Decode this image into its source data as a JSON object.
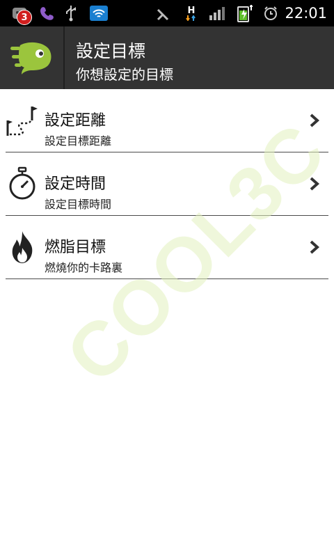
{
  "status_bar": {
    "notification_count": "3",
    "time": "22:01",
    "network_label": "H",
    "icons": [
      "app-notification-icon",
      "viber-icon",
      "usb-icon",
      "wifi-icon",
      "no-signal-icon",
      "data-transfer-icon",
      "signal-bars-icon",
      "battery-charging-icon",
      "alarm-icon"
    ]
  },
  "header": {
    "title": "設定目標",
    "subtitle": "你想設定的目標",
    "logo": "endomondo-logo-icon",
    "logo_color": "#9bc53d"
  },
  "list": {
    "items": [
      {
        "title": "設定距離",
        "subtitle": "設定目標距離",
        "icon": "distance-flags-icon"
      },
      {
        "title": "設定時間",
        "subtitle": "設定目標時間",
        "icon": "stopwatch-icon"
      },
      {
        "title": "燃脂目標",
        "subtitle": "燃燒你的卡路裏",
        "icon": "flame-icon"
      }
    ]
  },
  "watermark": {
    "text": "COOL3C"
  }
}
